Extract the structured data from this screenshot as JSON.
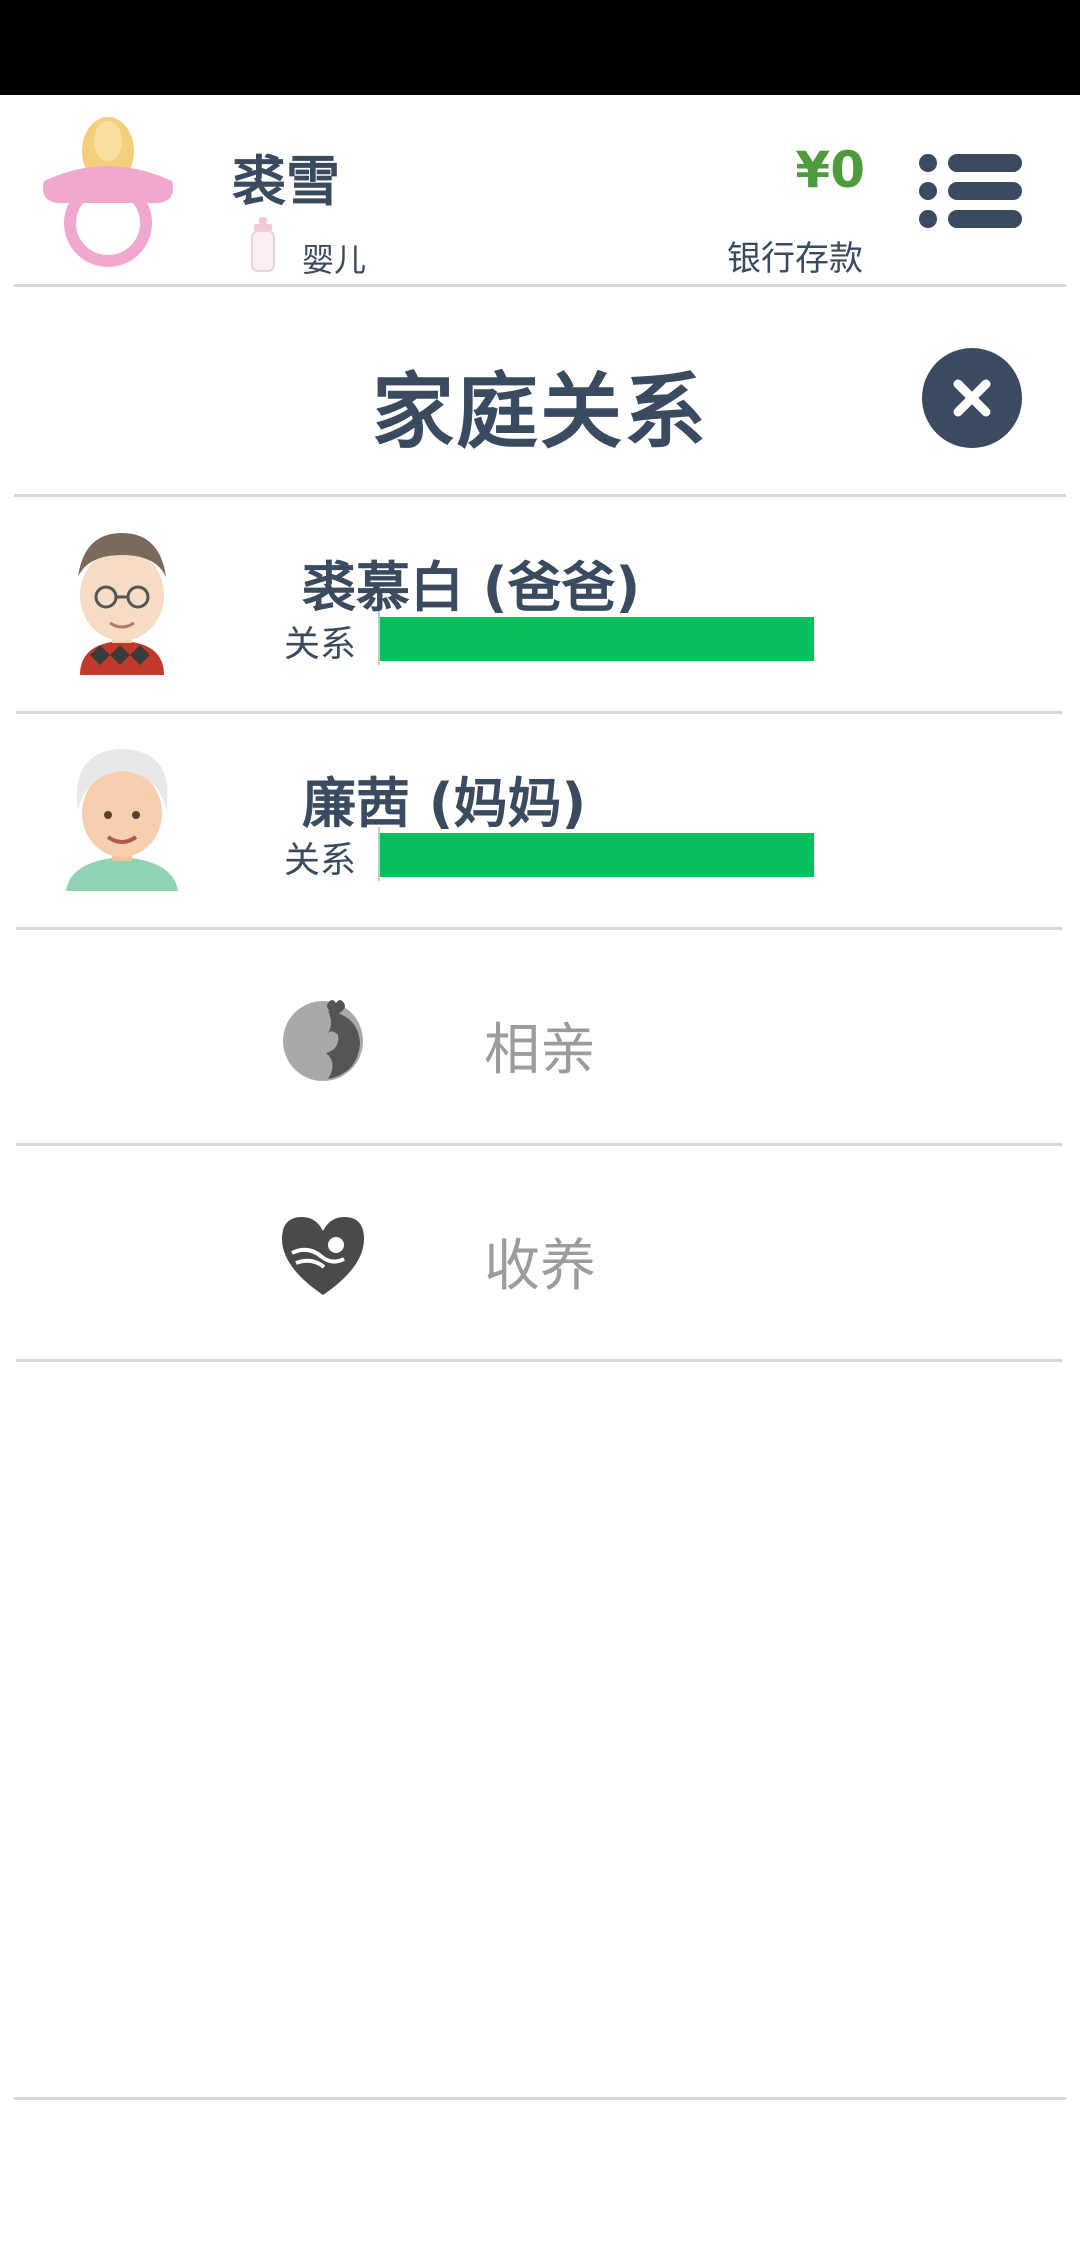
{
  "header": {
    "character_name": "裘雪",
    "life_stage": "婴儿",
    "money": "¥0",
    "bank_label": "银行存款",
    "money_color": "#4f9a3c"
  },
  "page": {
    "title": "家庭关系"
  },
  "relations": [
    {
      "name": "裘慕白 (爸爸)",
      "bar_label": "关系",
      "relationship_level": 1.0,
      "avatar_icon": "grandpa-avatar-icon"
    },
    {
      "name": "廉茜 (妈妈)",
      "bar_label": "关系",
      "relationship_level": 1.0,
      "avatar_icon": "grandma-avatar-icon"
    }
  ],
  "actions": [
    {
      "label": "相亲",
      "icon": "dating-couple-icon"
    },
    {
      "label": "收养",
      "icon": "adopt-heart-icon"
    }
  ],
  "colors": {
    "primary_text": "#3a4a5f",
    "bar_green": "#06bf5c",
    "muted_text": "#9c9c9c"
  }
}
